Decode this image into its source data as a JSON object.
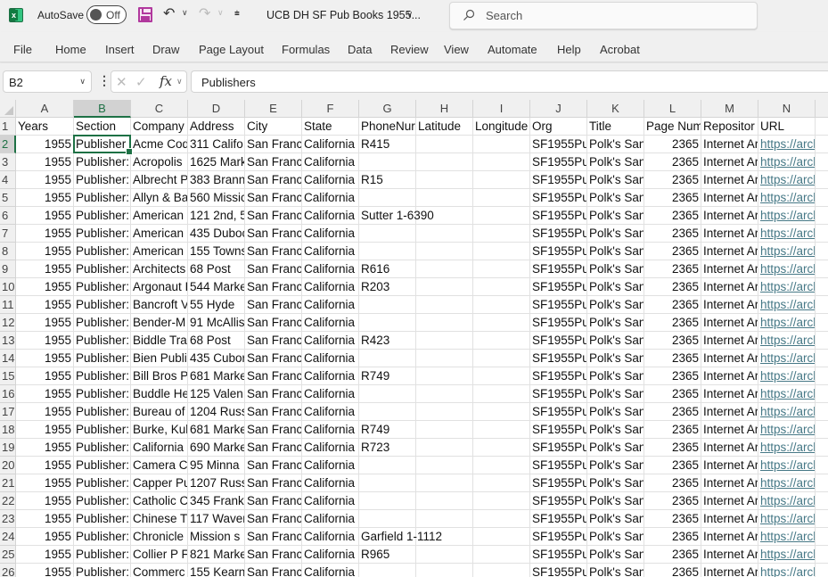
{
  "titlebar": {
    "app_icon": "excel-icon",
    "autosave_label": "AutoSave",
    "autosave_state": "Off",
    "save_icon": "save-icon",
    "undo_icon": "undo-icon",
    "redo_icon": "redo-icon",
    "customize_icon": "customize-qat-icon",
    "document_title": "UCB DH SF Pub Books 1955...",
    "search_placeholder": "Search"
  },
  "ribbon": {
    "tabs": [
      "File",
      "Home",
      "Insert",
      "Draw",
      "Page Layout",
      "Formulas",
      "Data",
      "Review",
      "View",
      "Automate",
      "Help",
      "Acrobat"
    ]
  },
  "formula_bar": {
    "name_box": "B2",
    "fx_label": "fx",
    "formula": "Publishers"
  },
  "sheet": {
    "column_letters": [
      "A",
      "B",
      "C",
      "D",
      "E",
      "F",
      "G",
      "H",
      "I",
      "J",
      "K",
      "L",
      "M",
      "N"
    ],
    "selected_column": "B",
    "selected_row": 2,
    "header_row": [
      "Years",
      "Section",
      "Company",
      "Address",
      "City",
      "State",
      "PhoneNur",
      "Latitude",
      "Longitude",
      "Org",
      "Title",
      "Page Num",
      "Repositor",
      "URL"
    ],
    "rows": [
      {
        "n": "2",
        "cells": [
          "1955",
          "Publisher",
          "Acme Cod",
          "311 Califo",
          "San Franc",
          "California",
          "R415",
          "",
          "",
          "SF1955Pul",
          "Polk's San",
          "2365",
          "Internet Ar",
          "https://archi"
        ]
      },
      {
        "n": "3",
        "cells": [
          "1955",
          "Publisher:",
          "Acropolis",
          "1625 Mark",
          "San Franc",
          "California",
          "",
          "",
          "",
          "SF1955Pul",
          "Polk's San",
          "2365",
          "Internet Ar",
          "https://archi"
        ]
      },
      {
        "n": "4",
        "cells": [
          "1955",
          "Publisher:",
          "Albrecht P",
          "383 Brann",
          "San Franc",
          "California",
          "R15",
          "",
          "",
          "SF1955Pul",
          "Polk's San",
          "2365",
          "Internet Ar",
          "https://archi"
        ]
      },
      {
        "n": "5",
        "cells": [
          "1955",
          "Publisher:",
          "Allyn & Ba",
          "560 Missic",
          "San Franc",
          "California",
          "",
          "",
          "",
          "SF1955Pul",
          "Polk's San",
          "2365",
          "Internet Ar",
          "https://archi"
        ]
      },
      {
        "n": "6",
        "cells": [
          "1955",
          "Publisher:",
          "American",
          "121 2nd, 5",
          "San Franc",
          "California",
          "Sutter 1-6390",
          "",
          "",
          "SF1955Pul",
          "Polk's San",
          "2365",
          "Internet Ar",
          "https://archi"
        ]
      },
      {
        "n": "7",
        "cells": [
          "1955",
          "Publisher:",
          "American",
          "435 Duboc",
          "San Franc",
          "California",
          "",
          "",
          "",
          "SF1955Pul",
          "Polk's San",
          "2365",
          "Internet Ar",
          "https://archi"
        ]
      },
      {
        "n": "8",
        "cells": [
          "1955",
          "Publisher:",
          "American",
          "155 Towns",
          "San Franc",
          "California",
          "",
          "",
          "",
          "SF1955Pul",
          "Polk's San",
          "2365",
          "Internet Ar",
          "https://archi"
        ]
      },
      {
        "n": "9",
        "cells": [
          "1955",
          "Publisher:",
          "Architects",
          "68 Post",
          "San Franc",
          "California",
          "R616",
          "",
          "",
          "SF1955Pul",
          "Polk's San",
          "2365",
          "Internet Ar",
          "https://archi"
        ]
      },
      {
        "n": "10",
        "cells": [
          "1955",
          "Publisher:",
          "Argonaut I",
          "544 Marke",
          "San Franc",
          "California",
          "R203",
          "",
          "",
          "SF1955Pul",
          "Polk's San",
          "2365",
          "Internet Ar",
          "https://archi"
        ]
      },
      {
        "n": "11",
        "cells": [
          "1955",
          "Publisher:",
          "Bancroft V",
          "55 Hyde",
          "San Franc",
          "California",
          "",
          "",
          "",
          "SF1955Pul",
          "Polk's San",
          "2365",
          "Internet Ar",
          "https://archi"
        ]
      },
      {
        "n": "12",
        "cells": [
          "1955",
          "Publisher:",
          "Bender-M",
          "91 McAllis",
          "San Franc",
          "California",
          "",
          "",
          "",
          "SF1955Pul",
          "Polk's San",
          "2365",
          "Internet Ar",
          "https://archi"
        ]
      },
      {
        "n": "13",
        "cells": [
          "1955",
          "Publisher:",
          "Biddle Tra",
          "68 Post",
          "San Franc",
          "California",
          "R423",
          "",
          "",
          "SF1955Pul",
          "Polk's San",
          "2365",
          "Internet Ar",
          "https://archi"
        ]
      },
      {
        "n": "14",
        "cells": [
          "1955",
          "Publisher:",
          "Bien Publi",
          "435 Cubor",
          "San Franc",
          "California",
          "",
          "",
          "",
          "SF1955Pul",
          "Polk's San",
          "2365",
          "Internet Ar",
          "https://archi"
        ]
      },
      {
        "n": "15",
        "cells": [
          "1955",
          "Publisher:",
          "Bill Bros P",
          "681 Marke",
          "San Franc",
          "California",
          "R749",
          "",
          "",
          "SF1955Pul",
          "Polk's San",
          "2365",
          "Internet Ar",
          "https://archi"
        ]
      },
      {
        "n": "16",
        "cells": [
          "1955",
          "Publisher:",
          "Buddle He",
          "125 Valen",
          "San Franc",
          "California",
          "",
          "",
          "",
          "SF1955Pul",
          "Polk's San",
          "2365",
          "Internet Ar",
          "https://archi"
        ]
      },
      {
        "n": "17",
        "cells": [
          "1955",
          "Publisher:",
          "Bureau of",
          "1204 Russ",
          "San Franc",
          "California",
          "",
          "",
          "",
          "SF1955Pul",
          "Polk's San",
          "2365",
          "Internet Ar",
          "https://archi"
        ]
      },
      {
        "n": "18",
        "cells": [
          "1955",
          "Publisher:",
          "Burke, Kul",
          "681 Marke",
          "San Franc",
          "California",
          "R749",
          "",
          "",
          "SF1955Pul",
          "Polk's San",
          "2365",
          "Internet Ar",
          "https://archi"
        ]
      },
      {
        "n": "19",
        "cells": [
          "1955",
          "Publisher:",
          "California",
          "690 Marke",
          "San Franc",
          "California",
          "R723",
          "",
          "",
          "SF1955Pul",
          "Polk's San",
          "2365",
          "Internet Ar",
          "https://archi"
        ]
      },
      {
        "n": "20",
        "cells": [
          "1955",
          "Publisher:",
          "Camera Cl",
          "95 Minna",
          "San Franc",
          "California",
          "",
          "",
          "",
          "SF1955Pul",
          "Polk's San",
          "2365",
          "Internet Ar",
          "https://archi"
        ]
      },
      {
        "n": "21",
        "cells": [
          "1955",
          "Publisher:",
          "Capper Pu",
          "1207 Russ",
          "San Franc",
          "California",
          "",
          "",
          "",
          "SF1955Pul",
          "Polk's San",
          "2365",
          "Internet Ar",
          "https://archi"
        ]
      },
      {
        "n": "22",
        "cells": [
          "1955",
          "Publisher:",
          "Catholic C",
          "345 Frankl",
          "San Franc",
          "California",
          "",
          "",
          "",
          "SF1955Pul",
          "Polk's San",
          "2365",
          "Internet Ar",
          "https://archi"
        ]
      },
      {
        "n": "23",
        "cells": [
          "1955",
          "Publisher:",
          "Chinese Ti",
          "117 Waver",
          "San Franc",
          "California",
          "",
          "",
          "",
          "SF1955Pul",
          "Polk's San",
          "2365",
          "Internet Ar",
          "https://archi"
        ]
      },
      {
        "n": "24",
        "cells": [
          "1955",
          "Publisher:",
          "Chronicle",
          "Mission s",
          "San Franc",
          "California",
          "Garfield 1-1112",
          "",
          "",
          "SF1955Pul",
          "Polk's San",
          "2365",
          "Internet Ar",
          "https://archi"
        ]
      },
      {
        "n": "25",
        "cells": [
          "1955",
          "Publisher:",
          "Collier P F",
          "821 Marke",
          "San Franc",
          "California",
          "R965",
          "",
          "",
          "SF1955Pul",
          "Polk's San",
          "2365",
          "Internet Ar",
          "https://archi"
        ]
      },
      {
        "n": "26",
        "cells": [
          "1955",
          "Publisher:",
          "Commerc",
          "155 Kearn",
          "San Franc",
          "California",
          "",
          "",
          "",
          "SF1955Pul",
          "Polk's San",
          "2365",
          "Internet Ar",
          "https://archi"
        ]
      }
    ]
  },
  "colors": {
    "accent_green": "#1e7145",
    "link": "#467886",
    "save_purple": "#b1389d"
  }
}
